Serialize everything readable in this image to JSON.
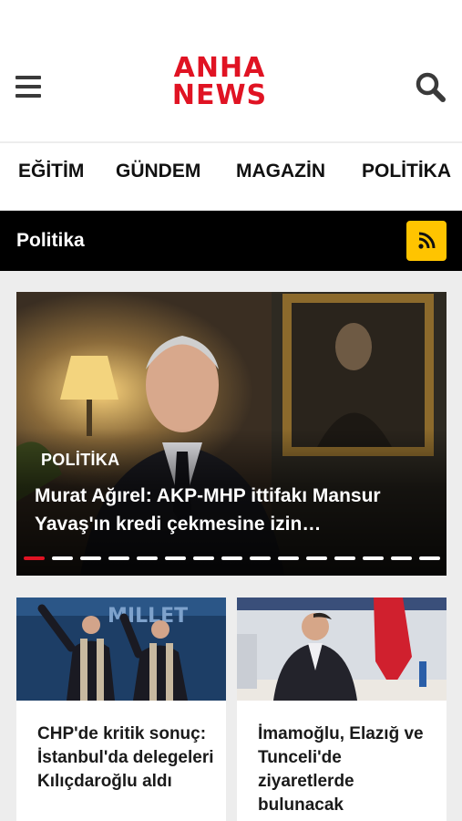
{
  "header": {
    "logo_line1": "ANHA",
    "logo_line2": "NEWS",
    "menu_icon": "hamburger-menu-icon",
    "search_icon": "search-icon",
    "brand_color": "#e01323"
  },
  "categories": [
    "EĞİTİM",
    "GÜNDEM",
    "MAGAZİN",
    "POLİTİKA"
  ],
  "section": {
    "title": "Politika",
    "rss_icon": "rss-icon",
    "rss_color": "#ffc400"
  },
  "hero": {
    "category": "POLİTİKA",
    "title": "Murat Ağırel: AKP-MHP ittifakı Mansur Yavaş'ın kredi çekmesine izin…",
    "slide_count": 15,
    "active_slide": 1
  },
  "cards": [
    {
      "title": "CHP'de kritik sonuç: İstanbul'da delegeleri Kılıçdaroğlu aldı"
    },
    {
      "title": "İmamoğlu, Elazığ ve Tunceli'de ziyaretlerde bulunacak"
    }
  ]
}
